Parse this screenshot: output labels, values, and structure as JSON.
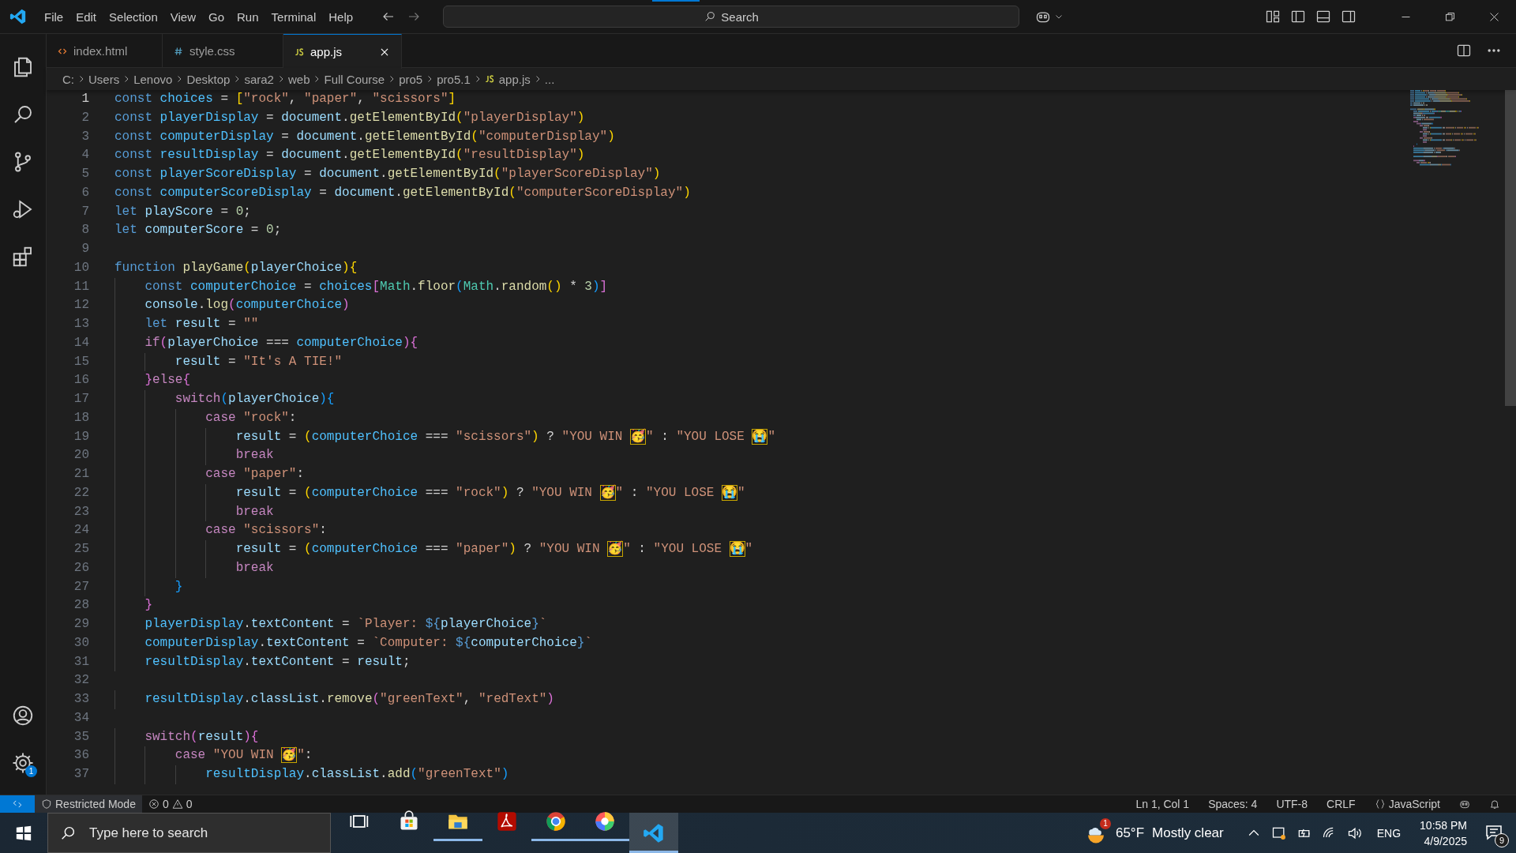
{
  "title_bar": {
    "menus": [
      "File",
      "Edit",
      "Selection",
      "View",
      "Go",
      "Run",
      "Terminal",
      "Help"
    ],
    "search": {
      "label": "Search"
    }
  },
  "activity_bar": {
    "top": [
      {
        "kind": "files"
      },
      {
        "kind": "search"
      },
      {
        "kind": "source-control"
      },
      {
        "kind": "run-debug"
      },
      {
        "kind": "extensions"
      }
    ],
    "bottom": [
      {
        "kind": "account"
      },
      {
        "kind": "gear",
        "badge": "1"
      }
    ]
  },
  "tabs": [
    {
      "label": "index.html",
      "kind": "html",
      "selected": false
    },
    {
      "label": "style.css",
      "kind": "css",
      "selected": false
    },
    {
      "label": "app.js",
      "kind": "js",
      "selected": true
    }
  ],
  "breadcrumb": [
    {
      "label": "C:",
      "kind": "folder"
    },
    {
      "label": "Users",
      "kind": "folder"
    },
    {
      "label": "Lenovo",
      "kind": "folder"
    },
    {
      "label": "Desktop",
      "kind": "folder"
    },
    {
      "label": "sara2",
      "kind": "folder"
    },
    {
      "label": "web",
      "kind": "folder"
    },
    {
      "label": "Full Course",
      "kind": "folder"
    },
    {
      "label": "pro5",
      "kind": "folder"
    },
    {
      "label": "pro5.1",
      "kind": "folder"
    },
    {
      "label": "app.js",
      "kind": "js"
    },
    {
      "label": "...",
      "kind": "more"
    }
  ],
  "editor": {
    "lines": [
      {
        "number": "1",
        "current": true,
        "tokens": [
          {
            "kind": "keyword",
            "text": "const "
          },
          {
            "kind": "constant",
            "text": "choices"
          },
          {
            "kind": "punctuation",
            "text": " = "
          },
          {
            "kind": "bracket1",
            "text": "["
          },
          {
            "kind": "string",
            "text": "\"rock\""
          },
          {
            "kind": "punctuation",
            "text": ", "
          },
          {
            "kind": "string",
            "text": "\"paper\""
          },
          {
            "kind": "punctuation",
            "text": ", "
          },
          {
            "kind": "string",
            "text": "\"scissors\""
          },
          {
            "kind": "bracket1",
            "text": "]"
          }
        ]
      },
      {
        "number": "2",
        "current": false,
        "tokens": [
          {
            "kind": "keyword",
            "text": "const "
          },
          {
            "kind": "constant",
            "text": "playerDisplay"
          },
          {
            "kind": "punctuation",
            "text": " = "
          },
          {
            "kind": "variable",
            "text": "document"
          },
          {
            "kind": "punctuation",
            "text": "."
          },
          {
            "kind": "function",
            "text": "getElementById"
          },
          {
            "kind": "bracket1",
            "text": "("
          },
          {
            "kind": "string",
            "text": "\"playerDisplay\""
          },
          {
            "kind": "bracket1",
            "text": ")"
          }
        ]
      },
      {
        "number": "3",
        "current": false,
        "tokens": [
          {
            "kind": "keyword",
            "text": "const "
          },
          {
            "kind": "constant",
            "text": "computerDisplay"
          },
          {
            "kind": "punctuation",
            "text": " = "
          },
          {
            "kind": "variable",
            "text": "document"
          },
          {
            "kind": "punctuation",
            "text": "."
          },
          {
            "kind": "function",
            "text": "getElementById"
          },
          {
            "kind": "bracket1",
            "text": "("
          },
          {
            "kind": "string",
            "text": "\"computerDisplay\""
          },
          {
            "kind": "bracket1",
            "text": ")"
          }
        ]
      },
      {
        "number": "4",
        "current": false,
        "tokens": [
          {
            "kind": "keyword",
            "text": "const "
          },
          {
            "kind": "constant",
            "text": "resultDisplay"
          },
          {
            "kind": "punctuation",
            "text": " = "
          },
          {
            "kind": "variable",
            "text": "document"
          },
          {
            "kind": "punctuation",
            "text": "."
          },
          {
            "kind": "function",
            "text": "getElementById"
          },
          {
            "kind": "bracket1",
            "text": "("
          },
          {
            "kind": "string",
            "text": "\"resultDisplay\""
          },
          {
            "kind": "bracket1",
            "text": ")"
          }
        ]
      },
      {
        "number": "5",
        "current": false,
        "tokens": [
          {
            "kind": "keyword",
            "text": "const "
          },
          {
            "kind": "constant",
            "text": "playerScoreDisplay"
          },
          {
            "kind": "punctuation",
            "text": " = "
          },
          {
            "kind": "variable",
            "text": "document"
          },
          {
            "kind": "punctuation",
            "text": "."
          },
          {
            "kind": "function",
            "text": "getElementById"
          },
          {
            "kind": "bracket1",
            "text": "("
          },
          {
            "kind": "string",
            "text": "\"playerScoreDisplay\""
          },
          {
            "kind": "bracket1",
            "text": ")"
          }
        ]
      },
      {
        "number": "6",
        "current": false,
        "tokens": [
          {
            "kind": "keyword",
            "text": "const "
          },
          {
            "kind": "constant",
            "text": "computerScoreDisplay"
          },
          {
            "kind": "punctuation",
            "text": " = "
          },
          {
            "kind": "variable",
            "text": "document"
          },
          {
            "kind": "punctuation",
            "text": "."
          },
          {
            "kind": "function",
            "text": "getElementById"
          },
          {
            "kind": "bracket1",
            "text": "("
          },
          {
            "kind": "string",
            "text": "\"computerScoreDisplay\""
          },
          {
            "kind": "bracket1",
            "text": ")"
          }
        ]
      },
      {
        "number": "7",
        "current": false,
        "tokens": [
          {
            "kind": "keyword",
            "text": "let "
          },
          {
            "kind": "variable",
            "text": "playScore"
          },
          {
            "kind": "punctuation",
            "text": " = "
          },
          {
            "kind": "number",
            "text": "0"
          },
          {
            "kind": "punctuation",
            "text": ";"
          }
        ]
      },
      {
        "number": "8",
        "current": false,
        "tokens": [
          {
            "kind": "keyword",
            "text": "let "
          },
          {
            "kind": "variable",
            "text": "computerScore"
          },
          {
            "kind": "punctuation",
            "text": " = "
          },
          {
            "kind": "number",
            "text": "0"
          },
          {
            "kind": "punctuation",
            "text": ";"
          }
        ]
      },
      {
        "number": "9",
        "current": false
      },
      {
        "number": "10",
        "current": false,
        "tokens": [
          {
            "kind": "keyword",
            "text": "function "
          },
          {
            "kind": "function",
            "text": "playGame"
          },
          {
            "kind": "bracket1",
            "text": "("
          },
          {
            "kind": "variable",
            "text": "playerChoice"
          },
          {
            "kind": "bracket1",
            "text": "){"
          }
        ]
      },
      {
        "number": "11",
        "current": false,
        "tokens": [
          {
            "kind": "keyword",
            "text": "    const "
          },
          {
            "kind": "constant",
            "text": "computerChoice"
          },
          {
            "kind": "punctuation",
            "text": " = "
          },
          {
            "kind": "constant",
            "text": "choices"
          },
          {
            "kind": "bracket2",
            "text": "["
          },
          {
            "kind": "class",
            "text": "Math"
          },
          {
            "kind": "punctuation",
            "text": "."
          },
          {
            "kind": "function",
            "text": "floor"
          },
          {
            "kind": "bracket3",
            "text": "("
          },
          {
            "kind": "class",
            "text": "Math"
          },
          {
            "kind": "punctuation",
            "text": "."
          },
          {
            "kind": "function",
            "text": "random"
          },
          {
            "kind": "bracket1",
            "text": "()"
          },
          {
            "kind": "punctuation",
            "text": " * "
          },
          {
            "kind": "number",
            "text": "3"
          },
          {
            "kind": "bracket3",
            "text": ")"
          },
          {
            "kind": "bracket2",
            "text": "]"
          }
        ]
      },
      {
        "number": "12",
        "current": false,
        "tokens": [
          {
            "kind": "variable",
            "text": "    console"
          },
          {
            "kind": "punctuation",
            "text": "."
          },
          {
            "kind": "function",
            "text": "log"
          },
          {
            "kind": "bracket2",
            "text": "("
          },
          {
            "kind": "constant",
            "text": "computerChoice"
          },
          {
            "kind": "bracket2",
            "text": ")"
          }
        ]
      },
      {
        "number": "13",
        "current": false,
        "tokens": [
          {
            "kind": "keyword",
            "text": "    let "
          },
          {
            "kind": "variable",
            "text": "result"
          },
          {
            "kind": "punctuation",
            "text": " = "
          },
          {
            "kind": "string",
            "text": "\"\""
          }
        ]
      },
      {
        "number": "14",
        "current": false,
        "tokens": [
          {
            "kind": "control",
            "text": "    if"
          },
          {
            "kind": "bracket2",
            "text": "("
          },
          {
            "kind": "variable",
            "text": "playerChoice"
          },
          {
            "kind": "punctuation",
            "text": " === "
          },
          {
            "kind": "constant",
            "text": "computerChoice"
          },
          {
            "kind": "bracket2",
            "text": "){"
          }
        ]
      },
      {
        "number": "15",
        "current": false,
        "tokens": [
          {
            "kind": "variable",
            "text": "        result"
          },
          {
            "kind": "punctuation",
            "text": " = "
          },
          {
            "kind": "string",
            "text": "\"It's A TIE!\""
          }
        ]
      },
      {
        "number": "16",
        "current": false,
        "tokens": [
          {
            "kind": "bracket2",
            "text": "    }"
          },
          {
            "kind": "control",
            "text": "else"
          },
          {
            "kind": "bracket2",
            "text": "{"
          }
        ]
      },
      {
        "number": "17",
        "current": false,
        "tokens": [
          {
            "kind": "control",
            "text": "        switch"
          },
          {
            "kind": "bracket3",
            "text": "("
          },
          {
            "kind": "variable",
            "text": "playerChoice"
          },
          {
            "kind": "bracket3",
            "text": "){"
          }
        ]
      },
      {
        "number": "18",
        "current": false,
        "tokens": [
          {
            "kind": "control",
            "text": "            case "
          },
          {
            "kind": "string",
            "text": "\"rock\""
          },
          {
            "kind": "punctuation",
            "text": ":"
          }
        ]
      },
      {
        "number": "19",
        "current": false,
        "tokens": [
          {
            "kind": "variable",
            "text": "                result"
          },
          {
            "kind": "punctuation",
            "text": " = "
          },
          {
            "kind": "bracket1",
            "text": "("
          },
          {
            "kind": "constant",
            "text": "computerChoice"
          },
          {
            "kind": "punctuation",
            "text": " === "
          },
          {
            "kind": "string",
            "text": "\"scissors\""
          },
          {
            "kind": "bracket1",
            "text": ")"
          },
          {
            "kind": "punctuation",
            "text": " ? "
          },
          {
            "kind": "string",
            "text": "\"YOU WIN "
          },
          {
            "kind": "emoji",
            "text": "🥳"
          },
          {
            "kind": "string",
            "text": "\""
          },
          {
            "kind": "punctuation",
            "text": " : "
          },
          {
            "kind": "string",
            "text": "\"YOU LOSE "
          },
          {
            "kind": "emoji",
            "text": "😭"
          },
          {
            "kind": "string",
            "text": "\""
          }
        ]
      },
      {
        "number": "20",
        "current": false,
        "tokens": [
          {
            "kind": "control",
            "text": "                break"
          }
        ]
      },
      {
        "number": "21",
        "current": false,
        "tokens": [
          {
            "kind": "control",
            "text": "            case "
          },
          {
            "kind": "string",
            "text": "\"paper\""
          },
          {
            "kind": "punctuation",
            "text": ":"
          }
        ]
      },
      {
        "number": "22",
        "current": false,
        "tokens": [
          {
            "kind": "variable",
            "text": "                result"
          },
          {
            "kind": "punctuation",
            "text": " = "
          },
          {
            "kind": "bracket1",
            "text": "("
          },
          {
            "kind": "constant",
            "text": "computerChoice"
          },
          {
            "kind": "punctuation",
            "text": " === "
          },
          {
            "kind": "string",
            "text": "\"rock\""
          },
          {
            "kind": "bracket1",
            "text": ")"
          },
          {
            "kind": "punctuation",
            "text": " ? "
          },
          {
            "kind": "string",
            "text": "\"YOU WIN "
          },
          {
            "kind": "emoji",
            "text": "🥳"
          },
          {
            "kind": "string",
            "text": "\""
          },
          {
            "kind": "punctuation",
            "text": " : "
          },
          {
            "kind": "string",
            "text": "\"YOU LOSE "
          },
          {
            "kind": "emoji",
            "text": "😭"
          },
          {
            "kind": "string",
            "text": "\""
          }
        ]
      },
      {
        "number": "23",
        "current": false,
        "tokens": [
          {
            "kind": "control",
            "text": "                break"
          }
        ]
      },
      {
        "number": "24",
        "current": false,
        "tokens": [
          {
            "kind": "control",
            "text": "            case "
          },
          {
            "kind": "string",
            "text": "\"scissors\""
          },
          {
            "kind": "punctuation",
            "text": ":"
          }
        ]
      },
      {
        "number": "25",
        "current": false,
        "tokens": [
          {
            "kind": "variable",
            "text": "                result"
          },
          {
            "kind": "punctuation",
            "text": " = "
          },
          {
            "kind": "bracket1",
            "text": "("
          },
          {
            "kind": "constant",
            "text": "computerChoice"
          },
          {
            "kind": "punctuation",
            "text": " === "
          },
          {
            "kind": "string",
            "text": "\"paper\""
          },
          {
            "kind": "bracket1",
            "text": ")"
          },
          {
            "kind": "punctuation",
            "text": " ? "
          },
          {
            "kind": "string",
            "text": "\"YOU WIN "
          },
          {
            "kind": "emoji",
            "text": "🥳"
          },
          {
            "kind": "string",
            "text": "\""
          },
          {
            "kind": "punctuation",
            "text": " : "
          },
          {
            "kind": "string",
            "text": "\"YOU LOSE "
          },
          {
            "kind": "emoji",
            "text": "😭"
          },
          {
            "kind": "string",
            "text": "\""
          }
        ]
      },
      {
        "number": "26",
        "current": false,
        "tokens": [
          {
            "kind": "control",
            "text": "                break"
          }
        ]
      },
      {
        "number": "27",
        "current": false,
        "tokens": [
          {
            "kind": "bracket3",
            "text": "        }"
          }
        ]
      },
      {
        "number": "28",
        "current": false,
        "tokens": [
          {
            "kind": "bracket2",
            "text": "    }"
          }
        ]
      },
      {
        "number": "29",
        "current": false,
        "tokens": [
          {
            "kind": "constant",
            "text": "    playerDisplay"
          },
          {
            "kind": "punctuation",
            "text": "."
          },
          {
            "kind": "variable",
            "text": "textContent"
          },
          {
            "kind": "punctuation",
            "text": " = "
          },
          {
            "kind": "string",
            "text": "`Player: "
          },
          {
            "kind": "keyword",
            "text": "${"
          },
          {
            "kind": "variable",
            "text": "playerChoice"
          },
          {
            "kind": "keyword",
            "text": "}"
          },
          {
            "kind": "string",
            "text": "`"
          }
        ]
      },
      {
        "number": "30",
        "current": false,
        "tokens": [
          {
            "kind": "constant",
            "text": "    computerDisplay"
          },
          {
            "kind": "punctuation",
            "text": "."
          },
          {
            "kind": "variable",
            "text": "textContent"
          },
          {
            "kind": "punctuation",
            "text": " = "
          },
          {
            "kind": "string",
            "text": "`Computer: "
          },
          {
            "kind": "keyword",
            "text": "${"
          },
          {
            "kind": "variable",
            "text": "computerChoice"
          },
          {
            "kind": "keyword",
            "text": "}"
          },
          {
            "kind": "string",
            "text": "`"
          }
        ]
      },
      {
        "number": "31",
        "current": false,
        "tokens": [
          {
            "kind": "constant",
            "text": "    resultDisplay"
          },
          {
            "kind": "punctuation",
            "text": "."
          },
          {
            "kind": "variable",
            "text": "textContent"
          },
          {
            "kind": "punctuation",
            "text": " = "
          },
          {
            "kind": "variable",
            "text": "result"
          },
          {
            "kind": "punctuation",
            "text": ";"
          }
        ]
      },
      {
        "number": "32",
        "current": false
      },
      {
        "number": "33",
        "current": false,
        "tokens": [
          {
            "kind": "constant",
            "text": "    resultDisplay"
          },
          {
            "kind": "punctuation",
            "text": "."
          },
          {
            "kind": "variable",
            "text": "classList"
          },
          {
            "kind": "punctuation",
            "text": "."
          },
          {
            "kind": "function",
            "text": "remove"
          },
          {
            "kind": "bracket2",
            "text": "("
          },
          {
            "kind": "string",
            "text": "\"greenText\""
          },
          {
            "kind": "punctuation",
            "text": ", "
          },
          {
            "kind": "string",
            "text": "\"redText\""
          },
          {
            "kind": "bracket2",
            "text": ")"
          }
        ]
      },
      {
        "number": "34",
        "current": false
      },
      {
        "number": "35",
        "current": false,
        "tokens": [
          {
            "kind": "control",
            "text": "    switch"
          },
          {
            "kind": "bracket2",
            "text": "("
          },
          {
            "kind": "variable",
            "text": "result"
          },
          {
            "kind": "bracket2",
            "text": "){"
          }
        ]
      },
      {
        "number": "36",
        "current": false,
        "tokens": [
          {
            "kind": "control",
            "text": "        case "
          },
          {
            "kind": "string",
            "text": "\"YOU WIN "
          },
          {
            "kind": "emoji",
            "text": "🥳"
          },
          {
            "kind": "string",
            "text": "\""
          },
          {
            "kind": "punctuation",
            "text": ":"
          }
        ]
      },
      {
        "number": "37",
        "current": false,
        "tokens": [
          {
            "kind": "constant",
            "text": "            resultDisplay"
          },
          {
            "kind": "punctuation",
            "text": "."
          },
          {
            "kind": "variable",
            "text": "classList"
          },
          {
            "kind": "punctuation",
            "text": "."
          },
          {
            "kind": "function",
            "text": "add"
          },
          {
            "kind": "bracket3",
            "text": "("
          },
          {
            "kind": "string",
            "text": "\"greenText\""
          },
          {
            "kind": "bracket3",
            "text": ")"
          }
        ]
      }
    ]
  },
  "status_bar": {
    "left": [
      {
        "kind": "remote"
      },
      {
        "kind": "restricted",
        "label": "Restricted Mode"
      },
      {
        "kind": "problems",
        "errors": "0",
        "warnings": "0"
      }
    ],
    "right": [
      {
        "kind": "text",
        "label": "Ln 1, Col 1"
      },
      {
        "kind": "text",
        "label": "Spaces: 4"
      },
      {
        "kind": "text",
        "label": "UTF-8"
      },
      {
        "kind": "text",
        "label": "CRLF"
      },
      {
        "kind": "language",
        "label": "JavaScript"
      },
      {
        "kind": "copilot"
      },
      {
        "kind": "bell"
      }
    ]
  },
  "taskbar": {
    "search": {
      "placeholder": "Type here to search"
    },
    "apps": [
      {
        "kind": "task-view",
        "running": false,
        "active": false
      },
      {
        "kind": "store",
        "running": false,
        "active": false
      },
      {
        "kind": "explorer",
        "running": true,
        "active": false
      },
      {
        "kind": "acrobat",
        "running": false,
        "active": false
      },
      {
        "kind": "chrome",
        "running": true,
        "active": false
      },
      {
        "kind": "color-wheel",
        "running": true,
        "active": false
      },
      {
        "kind": "vscode",
        "running": true,
        "active": true
      }
    ],
    "weather": {
      "badge": "1",
      "temperature": "65°F",
      "condition": "Mostly clear"
    },
    "tray": [
      {
        "kind": "chevron"
      },
      {
        "kind": "device"
      },
      {
        "kind": "battery"
      },
      {
        "kind": "wifi"
      },
      {
        "kind": "volume"
      }
    ],
    "language": "ENG",
    "time": "10:58 PM",
    "date": "4/9/2025",
    "notifications": "9"
  }
}
